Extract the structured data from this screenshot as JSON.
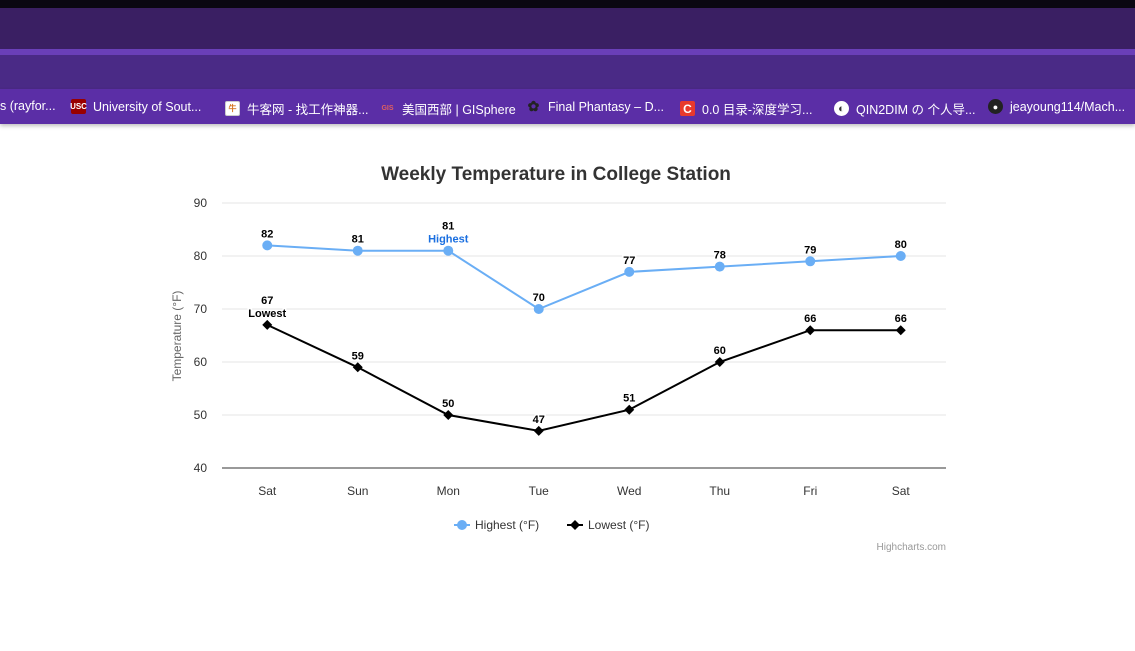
{
  "bookmarks": [
    {
      "label": "s (rayfor...",
      "icon": "bookmark-fragment-icon",
      "color": "#5b2ea6"
    },
    {
      "label": "University of Sout...",
      "icon": "usc-logo-icon",
      "color": "#990000"
    },
    {
      "label": "牛客网 - 找工作神器...",
      "icon": "nowcoder-icon",
      "color": "#ffffff"
    },
    {
      "label": "美国西部 | GISphere",
      "icon": "gis-icon",
      "color": "#5b2ea6"
    },
    {
      "label": "Final Phantasy – D...",
      "icon": "clover-icon",
      "color": "#5b2ea6"
    },
    {
      "label": "0.0 目录-深度学习...",
      "icon": "csdn-c-icon",
      "color": "#e8392c"
    },
    {
      "label": "QIN2DIM の 个人导...",
      "icon": "globe-icon",
      "color": "#5b2ea6"
    },
    {
      "label": "jeayoung114/Mach...",
      "icon": "github-icon",
      "color": "#5b2ea6"
    }
  ],
  "chart_data": {
    "type": "line",
    "title": "Weekly Temperature in College Station",
    "ylabel": "Temperature (°F)",
    "xlabel": "",
    "categories": [
      "Sat",
      "Sun",
      "Mon",
      "Tue",
      "Wed",
      "Thu",
      "Fri",
      "Sat"
    ],
    "ylim": [
      40,
      90
    ],
    "yticks": [
      40,
      50,
      60,
      70,
      80,
      90
    ],
    "grid": true,
    "legend_position": "bottom-center",
    "series": [
      {
        "name": "Highest (°F)",
        "values": [
          82,
          81,
          81,
          70,
          77,
          78,
          79,
          80
        ],
        "color": "#6aaef5",
        "marker": "circle"
      },
      {
        "name": "Lowest (°F)",
        "values": [
          67,
          59,
          50,
          47,
          51,
          60,
          66,
          66
        ],
        "color": "#000000",
        "marker": "diamond"
      }
    ],
    "annotations": [
      {
        "series": 0,
        "index": 2,
        "text": "Highest",
        "color": "#1a6fe0"
      },
      {
        "series": 1,
        "index": 0,
        "text": "Lowest",
        "color": "#000000"
      }
    ],
    "credits": "Highcharts.com"
  }
}
